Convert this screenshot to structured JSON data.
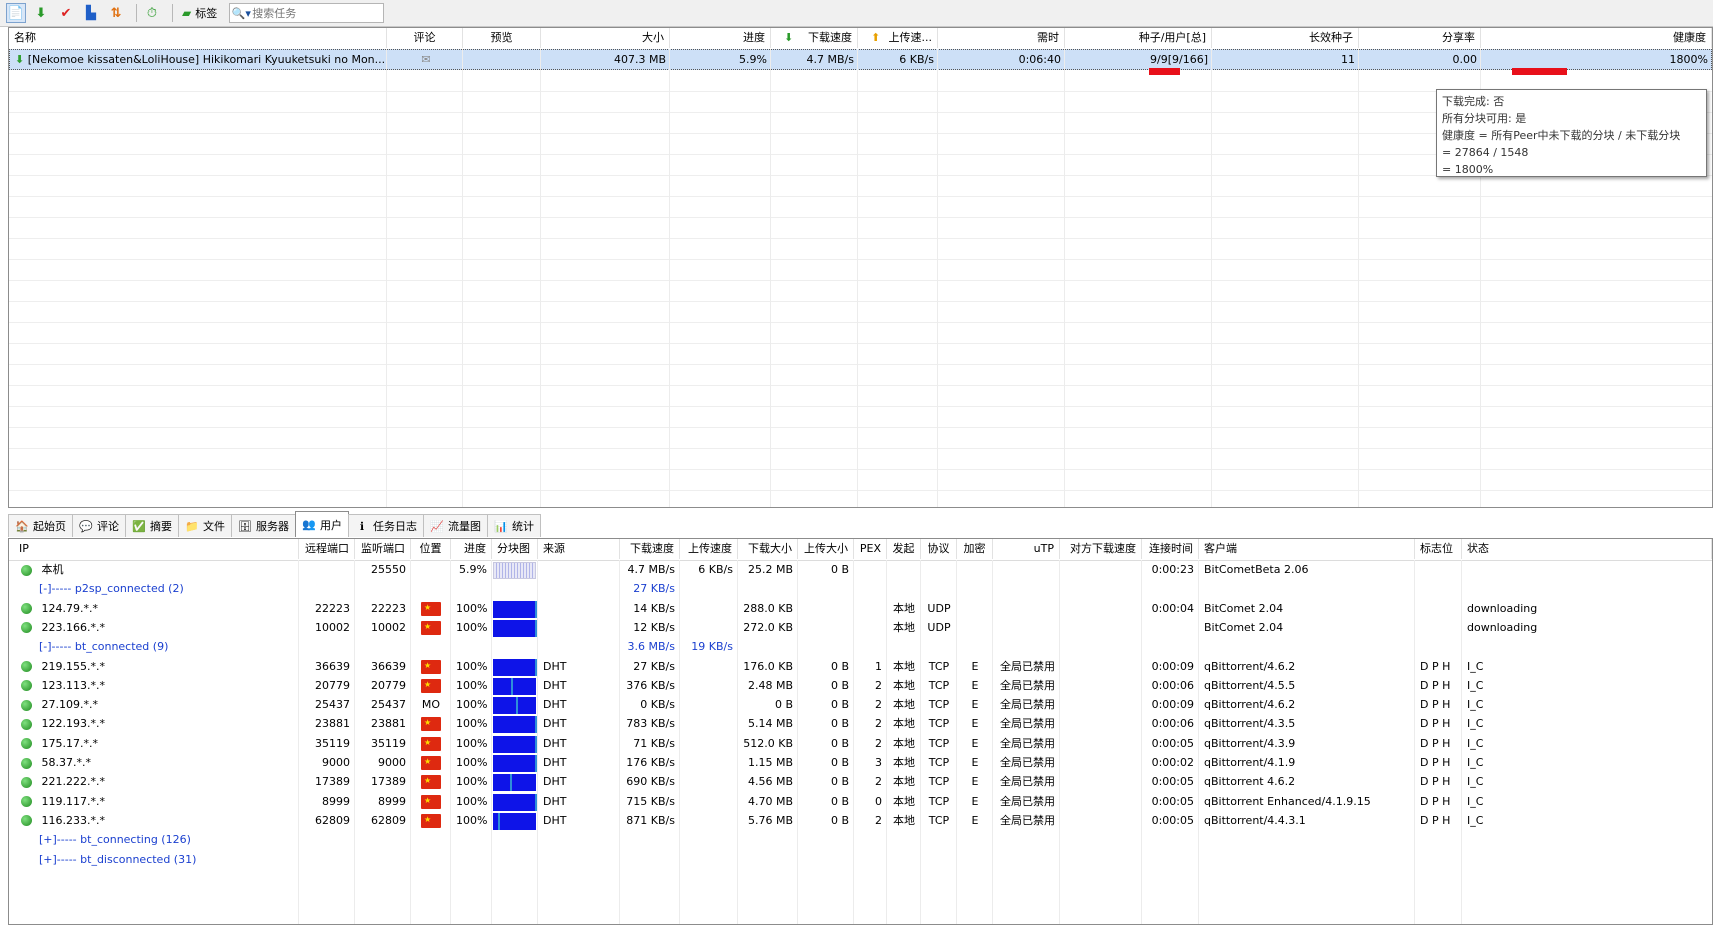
{
  "toolbar": {
    "label_button": "标签",
    "search_placeholder": "搜索任务"
  },
  "task_columns": [
    "名称",
    "评论",
    "预览",
    "大小",
    "进度",
    "下载速度",
    "上传速...",
    "需时",
    "种子/用户[总]",
    "长效种子",
    "分享率",
    "健康度"
  ],
  "task": {
    "name": "[Nekomoe kissaten&LoliHouse] Hikikomari Kyuuketsuki no Mon...",
    "size": "407.3 MB",
    "progress": "5.9%",
    "down_speed": "4.7 MB/s",
    "up_speed": "6 KB/s",
    "eta": "0:06:40",
    "seeds_peers": "9/9[9/166]",
    "long_seeds": "11",
    "ratio": "0.00",
    "health": "1800%"
  },
  "tooltip": {
    "lines": [
      "下载完成:  否",
      "所有分块可用:  是",
      "健康度 = 所有Peer中未下载的分块 / 未下载分块",
      " = 27864 / 1548",
      " = 1800%"
    ]
  },
  "tabs": [
    "起始页",
    "评论",
    "摘要",
    "文件",
    "服务器",
    "用户",
    "任务日志",
    "流量图",
    "统计"
  ],
  "active_tab": 5,
  "peer_columns": [
    "IP",
    "远程端口",
    "监听端口",
    "位置",
    "进度",
    "分块图",
    "来源",
    "下载速度",
    "上传速度",
    "下载大小",
    "上传大小",
    "PEX",
    "发起",
    "协议",
    "加密",
    "uTP",
    "对方下载速度",
    "连接时间",
    "客户端",
    "标志位",
    "状态"
  ],
  "peers": [
    {
      "kind": "peer",
      "ip": "本机",
      "rport": "",
      "lport": "25550",
      "loc": "",
      "progress": "5.9%",
      "local": true,
      "source": "",
      "down": "4.7 MB/s",
      "up": "6 KB/s",
      "dsize": "25.2 MB",
      "usize": "0 B",
      "pex": "",
      "init": "",
      "proto": "",
      "enc": "",
      "utp": "",
      "pdown": "",
      "time": "0:00:23",
      "client": "BitCometBeta 2.06",
      "flags": "",
      "status": ""
    },
    {
      "kind": "group",
      "label": "[-]----- p2sp_connected (2)",
      "down": "27 KB/s",
      "up": ""
    },
    {
      "kind": "peer",
      "ip": "124.79.*.*",
      "rport": "22223",
      "lport": "22223",
      "loc": "flag",
      "progress": "100%",
      "local": false,
      "source": "",
      "down": "14 KB/s",
      "up": "",
      "dsize": "288.0 KB",
      "usize": "",
      "pex": "",
      "init": "本地",
      "proto": "UDP",
      "enc": "",
      "utp": "",
      "pdown": "",
      "time": "0:00:04",
      "client": "BitComet 2.04",
      "flags": "",
      "status": "downloading"
    },
    {
      "kind": "peer",
      "ip": "223.166.*.*",
      "rport": "10002",
      "lport": "10002",
      "loc": "flag",
      "progress": "100%",
      "local": false,
      "source": "",
      "down": "12 KB/s",
      "up": "",
      "dsize": "272.0 KB",
      "usize": "",
      "pex": "",
      "init": "本地",
      "proto": "UDP",
      "enc": "",
      "utp": "",
      "pdown": "",
      "time": "",
      "client": "BitComet 2.04",
      "flags": "",
      "status": "downloading"
    },
    {
      "kind": "group",
      "label": "[-]----- bt_connected (9)",
      "down": "3.6 MB/s",
      "up": "19 KB/s"
    },
    {
      "kind": "peer",
      "ip": "219.155.*.*",
      "rport": "36639",
      "lport": "36639",
      "loc": "flag",
      "progress": "100%",
      "local": false,
      "source": "DHT",
      "down": "27 KB/s",
      "up": "",
      "dsize": "176.0 KB",
      "usize": "0 B",
      "pex": "1",
      "init": "本地",
      "proto": "TCP",
      "enc": "E",
      "utp": "全局已禁用",
      "pdown": "",
      "time": "0:00:09",
      "client": "qBittorrent/4.6.2",
      "flags": "D P H",
      "status": "I_C"
    },
    {
      "kind": "peer",
      "ip": "123.113.*.*",
      "rport": "20779",
      "lport": "20779",
      "loc": "flag",
      "progress": "100%",
      "local": false,
      "source": "DHT",
      "down": "376 KB/s",
      "up": "",
      "dsize": "2.48 MB",
      "usize": "0 B",
      "pex": "2",
      "init": "本地",
      "proto": "TCP",
      "enc": "E",
      "utp": "全局已禁用",
      "pdown": "",
      "time": "0:00:06",
      "client": "qBittorrent/4.5.5",
      "flags": "D P H",
      "status": "I_C"
    },
    {
      "kind": "peer",
      "ip": "27.109.*.*",
      "rport": "25437",
      "lport": "25437",
      "loc": "MO",
      "progress": "100%",
      "local": false,
      "source": "DHT",
      "down": "0 KB/s",
      "up": "",
      "dsize": "0 B",
      "usize": "0 B",
      "pex": "2",
      "init": "本地",
      "proto": "TCP",
      "enc": "E",
      "utp": "全局已禁用",
      "pdown": "",
      "time": "0:00:09",
      "client": "qBittorrent/4.6.2",
      "flags": "D P H",
      "status": "I_C"
    },
    {
      "kind": "peer",
      "ip": "122.193.*.*",
      "rport": "23881",
      "lport": "23881",
      "loc": "flag",
      "progress": "100%",
      "local": false,
      "source": "DHT",
      "down": "783 KB/s",
      "up": "",
      "dsize": "5.14 MB",
      "usize": "0 B",
      "pex": "2",
      "init": "本地",
      "proto": "TCP",
      "enc": "E",
      "utp": "全局已禁用",
      "pdown": "",
      "time": "0:00:06",
      "client": "qBittorrent/4.3.5",
      "flags": "D P H",
      "status": "I_C"
    },
    {
      "kind": "peer",
      "ip": "175.17.*.*",
      "rport": "35119",
      "lport": "35119",
      "loc": "flag",
      "progress": "100%",
      "local": false,
      "source": "DHT",
      "down": "71 KB/s",
      "up": "",
      "dsize": "512.0 KB",
      "usize": "0 B",
      "pex": "2",
      "init": "本地",
      "proto": "TCP",
      "enc": "E",
      "utp": "全局已禁用",
      "pdown": "",
      "time": "0:00:05",
      "client": "qBittorrent/4.3.9",
      "flags": "D P H",
      "status": "I_C"
    },
    {
      "kind": "peer",
      "ip": "58.37.*.*",
      "rport": "9000",
      "lport": "9000",
      "loc": "flag",
      "progress": "100%",
      "local": false,
      "source": "DHT",
      "down": "176 KB/s",
      "up": "",
      "dsize": "1.15 MB",
      "usize": "0 B",
      "pex": "3",
      "init": "本地",
      "proto": "TCP",
      "enc": "E",
      "utp": "全局已禁用",
      "pdown": "",
      "time": "0:00:02",
      "client": "qBittorrent/4.1.9",
      "flags": "D P H",
      "status": "I_C"
    },
    {
      "kind": "peer",
      "ip": "221.222.*.*",
      "rport": "17389",
      "lport": "17389",
      "loc": "flag",
      "progress": "100%",
      "local": false,
      "source": "DHT",
      "down": "690 KB/s",
      "up": "",
      "dsize": "4.56 MB",
      "usize": "0 B",
      "pex": "2",
      "init": "本地",
      "proto": "TCP",
      "enc": "E",
      "utp": "全局已禁用",
      "pdown": "",
      "time": "0:00:05",
      "client": "qBittorrent 4.6.2",
      "flags": "D P H",
      "status": "I_C"
    },
    {
      "kind": "peer",
      "ip": "119.117.*.*",
      "rport": "8999",
      "lport": "8999",
      "loc": "flag",
      "progress": "100%",
      "local": false,
      "source": "DHT",
      "down": "715 KB/s",
      "up": "",
      "dsize": "4.70 MB",
      "usize": "0 B",
      "pex": "0",
      "init": "本地",
      "proto": "TCP",
      "enc": "E",
      "utp": "全局已禁用",
      "pdown": "",
      "time": "0:00:05",
      "client": "qBittorrent Enhanced/4.1.9.15",
      "flags": "D P H",
      "status": "I_C"
    },
    {
      "kind": "peer",
      "ip": "116.233.*.*",
      "rport": "62809",
      "lport": "62809",
      "loc": "flag",
      "progress": "100%",
      "local": false,
      "source": "DHT",
      "down": "871 KB/s",
      "up": "",
      "dsize": "5.76 MB",
      "usize": "0 B",
      "pex": "2",
      "init": "本地",
      "proto": "TCP",
      "enc": "E",
      "utp": "全局已禁用",
      "pdown": "",
      "time": "0:00:05",
      "client": "qBittorrent/4.4.3.1",
      "flags": "D P H",
      "status": "I_C"
    },
    {
      "kind": "group",
      "label": "[+]----- bt_connecting (126)",
      "down": "",
      "up": ""
    },
    {
      "kind": "group",
      "label": "[+]----- bt_disconnected (31)",
      "down": "",
      "up": ""
    }
  ],
  "colors": {
    "selection": "#cde0f7",
    "piece_bar": "#0e14e8",
    "group_text": "#1a3fcf",
    "health_mark": "#e8101a"
  }
}
